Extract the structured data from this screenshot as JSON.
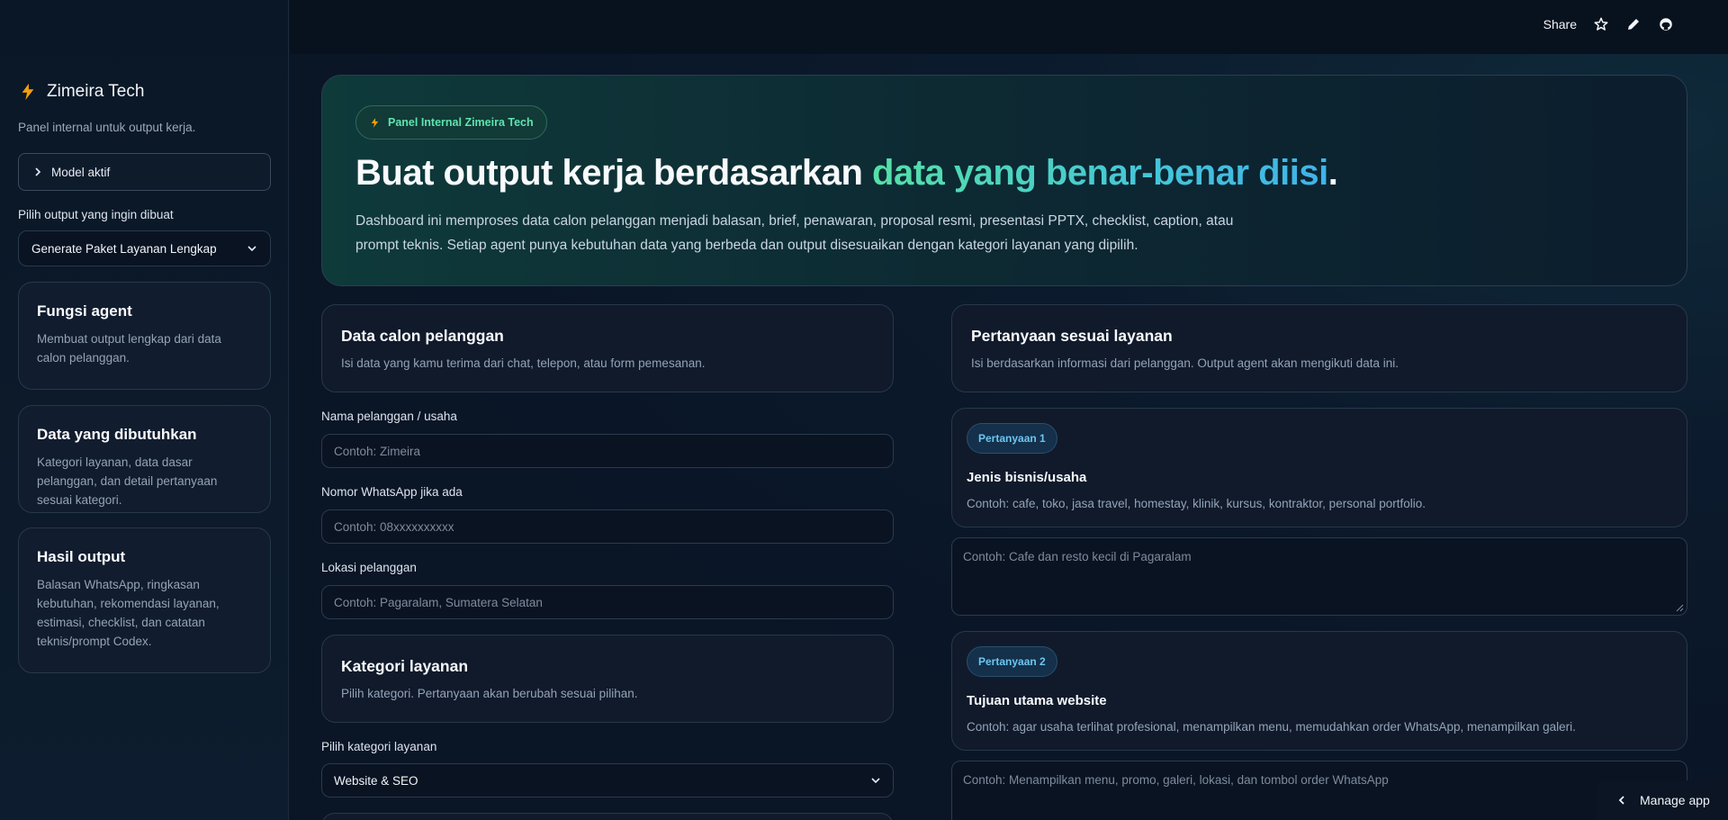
{
  "sidebar": {
    "brand_title": "Zimeira Tech",
    "brand_subtitle": "Panel internal untuk output kerja.",
    "model_expander": "Model aktif",
    "output_label": "Pilih output yang ingin dibuat",
    "output_selected": "Generate Paket Layanan Lengkap",
    "cards": [
      {
        "title": "Fungsi agent",
        "text": "Membuat output lengkap dari data calon pelanggan."
      },
      {
        "title": "Data yang dibutuhkan",
        "text": "Kategori layanan, data dasar pelanggan, dan detail pertanyaan sesuai kategori."
      },
      {
        "title": "Hasil output",
        "text": "Balasan WhatsApp, ringkasan kebutuhan, rekomendasi layanan, estimasi, checklist, dan catatan teknis/prompt Codex."
      }
    ]
  },
  "topbar": {
    "share_label": "Share"
  },
  "hero": {
    "badge": "Panel Internal Zimeira Tech",
    "title_start": "Buat output kerja berdasarkan ",
    "title_highlight": "data yang benar-benar diisi",
    "title_end": ".",
    "description": "Dashboard ini memproses data calon pelanggan menjadi balasan, brief, penawaran, proposal resmi, presentasi PPTX, checklist, caption, atau prompt teknis. Setiap agent punya kebutuhan data yang berbeda dan output disesuaikan dengan kategori layanan yang dipilih."
  },
  "customer": {
    "title": "Data calon pelanggan",
    "subtitle": "Isi data yang kamu terima dari chat, telepon, atau form pemesanan.",
    "name_label": "Nama pelanggan / usaha",
    "name_placeholder": "Contoh: Zimeira",
    "wa_label": "Nomor WhatsApp jika ada",
    "wa_placeholder": "Contoh: 08xxxxxxxxxx",
    "loc_label": "Lokasi pelanggan",
    "loc_placeholder": "Contoh: Pagaralam, Sumatera Selatan"
  },
  "category": {
    "title": "Kategori layanan",
    "subtitle": "Pilih kategori. Pertanyaan akan berubah sesuai pilihan.",
    "select_label": "Pilih kategori layanan",
    "selected": "Website & SEO"
  },
  "questions": {
    "title": "Pertanyaan sesuai layanan",
    "subtitle": "Isi berdasarkan informasi dari pelanggan. Output agent akan mengikuti data ini.",
    "items": [
      {
        "badge": "Pertanyaan 1",
        "title": "Jenis bisnis/usaha",
        "hint": "Contoh: cafe, toko, jasa travel, homestay, klinik, kursus, kontraktor, personal portfolio.",
        "placeholder": "Contoh: Cafe dan resto kecil di Pagaralam"
      },
      {
        "badge": "Pertanyaan 2",
        "title": "Tujuan utama website",
        "hint": "Contoh: agar usaha terlihat profesional, menampilkan menu, memudahkan order WhatsApp, menampilkan galeri.",
        "placeholder": "Contoh: Menampilkan menu, promo, galeri, lokasi, dan tombol order WhatsApp"
      }
    ]
  },
  "manage_app": "Manage app",
  "colors": {
    "accent_green": "#56e0a6",
    "accent_blue": "#3fb3e8",
    "bolt": "#f59e0b"
  }
}
